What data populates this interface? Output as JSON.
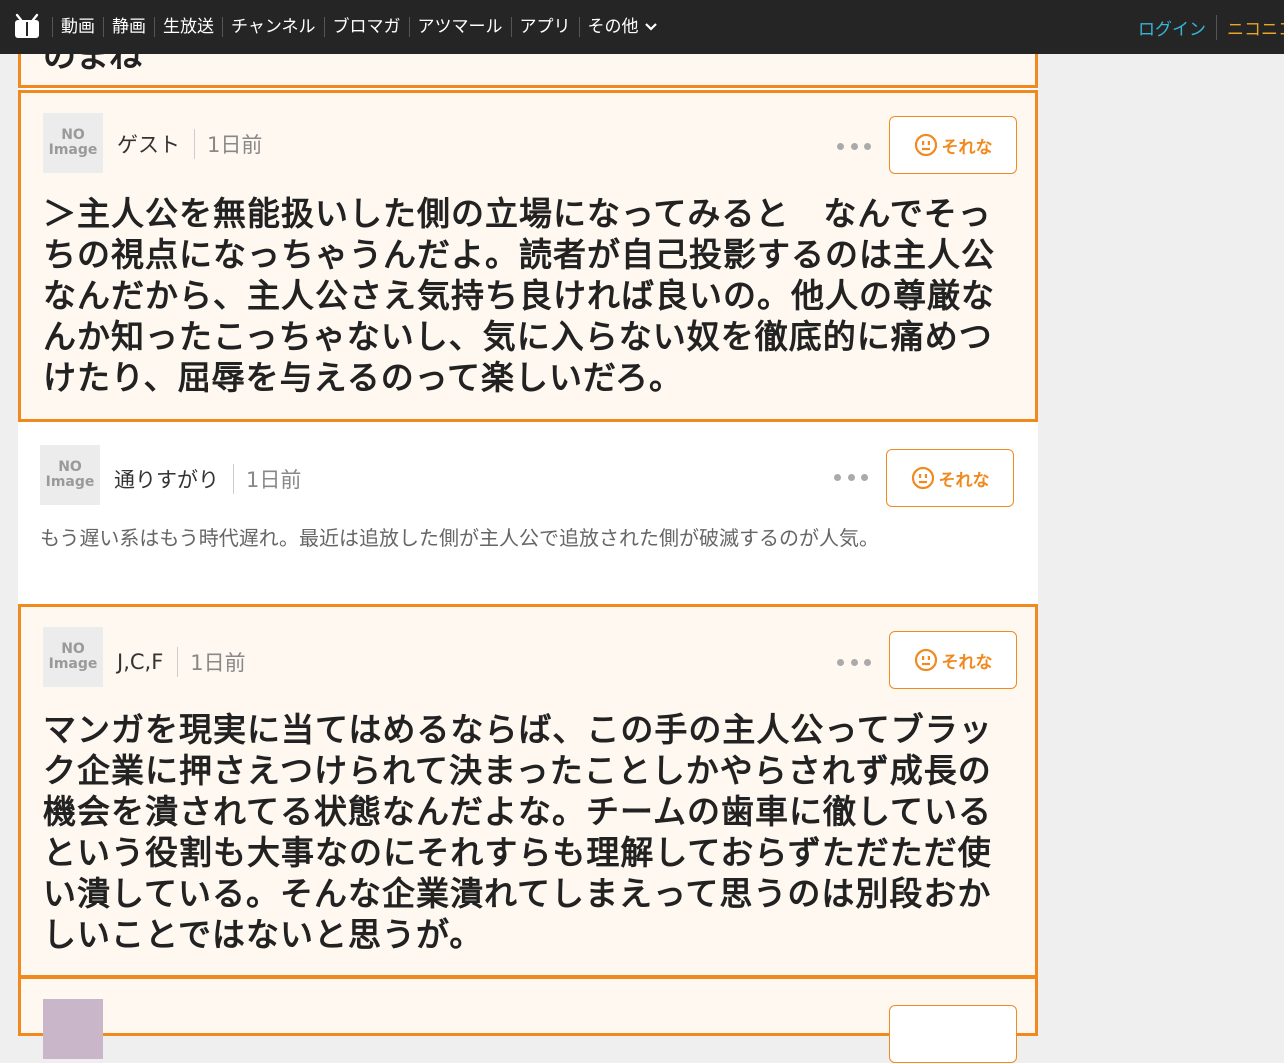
{
  "nav": {
    "items": [
      "動画",
      "静画",
      "生放送",
      "チャンネル",
      "ブロマガ",
      "アツマール",
      "アプリ"
    ],
    "more_label": "その他",
    "login": "ログイン",
    "niconico": "ニコニコ"
  },
  "comments": [
    {
      "partial_text": "のまね"
    },
    {
      "avatar_line1": "NO",
      "avatar_line2": "Image",
      "author": "ゲスト",
      "time": "1日前",
      "sorena": "それな",
      "text": "＞主人公を無能扱いした側の立場になってみると　なんでそっちの視点になっちゃうんだよ。読者が自己投影するのは主人公なんだから、主人公さえ気持ち良ければ良いの。他人の尊厳なんか知ったこっちゃないし、気に入らない奴を徹底的に痛めつけたり、屈辱を与えるのって楽しいだろ。"
    },
    {
      "avatar_line1": "NO",
      "avatar_line2": "Image",
      "author": "通りすがり",
      "time": "1日前",
      "sorena": "それな",
      "text": "もう遅い系はもう時代遅れ。最近は追放した側が主人公で追放された側が破滅するのが人気。"
    },
    {
      "avatar_line1": "NO",
      "avatar_line2": "Image",
      "author": "J,C,F",
      "time": "1日前",
      "sorena": "それな",
      "text": "マンガを現実に当てはめるならば、この手の主人公ってブラック企業に押さえつけられて決まったことしかやらされず成長の機会を潰されてる状態なんだよな。チームの歯車に徹しているという役割も大事なのにそれすらも理解しておらずただただ使い潰している。そんな企業潰れてしまえって思うのは別段おかしいことではないと思うが。"
    }
  ],
  "colors": {
    "accent": "#f08a1e",
    "topbar": "#252525",
    "login": "#36b6d6",
    "niconico": "#e8a626"
  }
}
